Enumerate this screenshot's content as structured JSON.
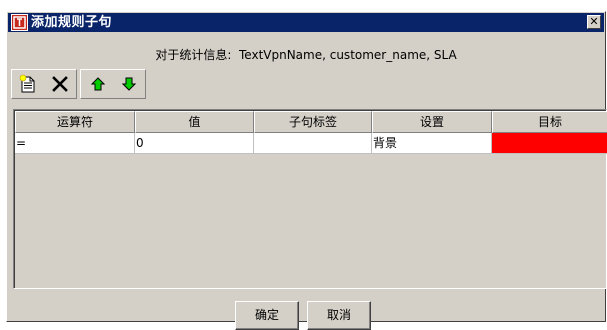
{
  "window": {
    "title": "添加规则子句",
    "close_glyph": "✕"
  },
  "info": {
    "label": "对于统计信息:",
    "value": "TextVpnName, customer_name, SLA"
  },
  "toolbar": {
    "items": [
      "new-document-icon",
      "delete-x-icon",
      "move-up-arrow-icon",
      "move-down-arrow-icon"
    ]
  },
  "table": {
    "columns": [
      "运算符",
      "值",
      "子句标签",
      "设置",
      "目标"
    ],
    "rows": [
      {
        "operator": "=",
        "value": "0",
        "clause_label": "",
        "setting": "背景",
        "target_color": "#ff0000"
      }
    ]
  },
  "buttons": {
    "ok": "确定",
    "cancel": "取消"
  },
  "colors": {
    "titlebar": "#0a246a",
    "face": "#d4d0c8",
    "target_fill": "#ff0000"
  }
}
